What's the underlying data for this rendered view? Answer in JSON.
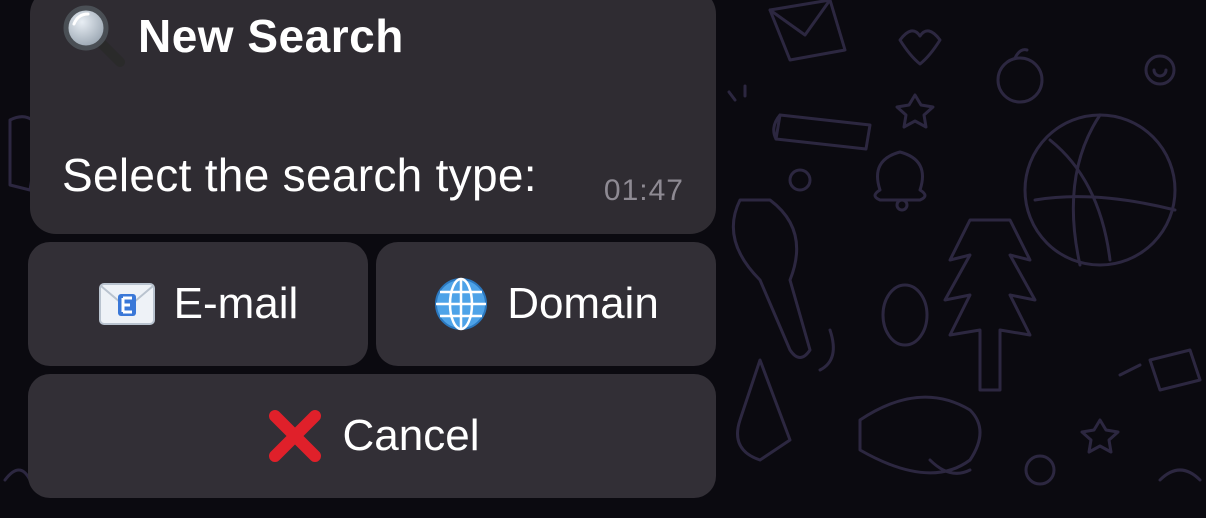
{
  "message": {
    "title": "New Search",
    "text": "Select the search type:",
    "time": "01:47",
    "title_icon": "magnifier-icon"
  },
  "keyboard": {
    "email": {
      "label": "E-mail",
      "icon": "envelope-icon"
    },
    "domain": {
      "label": "Domain",
      "icon": "globe-icon"
    },
    "cancel": {
      "label": "Cancel",
      "icon": "cross-mark-icon"
    }
  },
  "colors": {
    "background": "#0b0a10",
    "bubble": "#2f2c32",
    "button": "#322f36",
    "timestamp": "#8e8a93",
    "doodle": "#2c2740"
  }
}
